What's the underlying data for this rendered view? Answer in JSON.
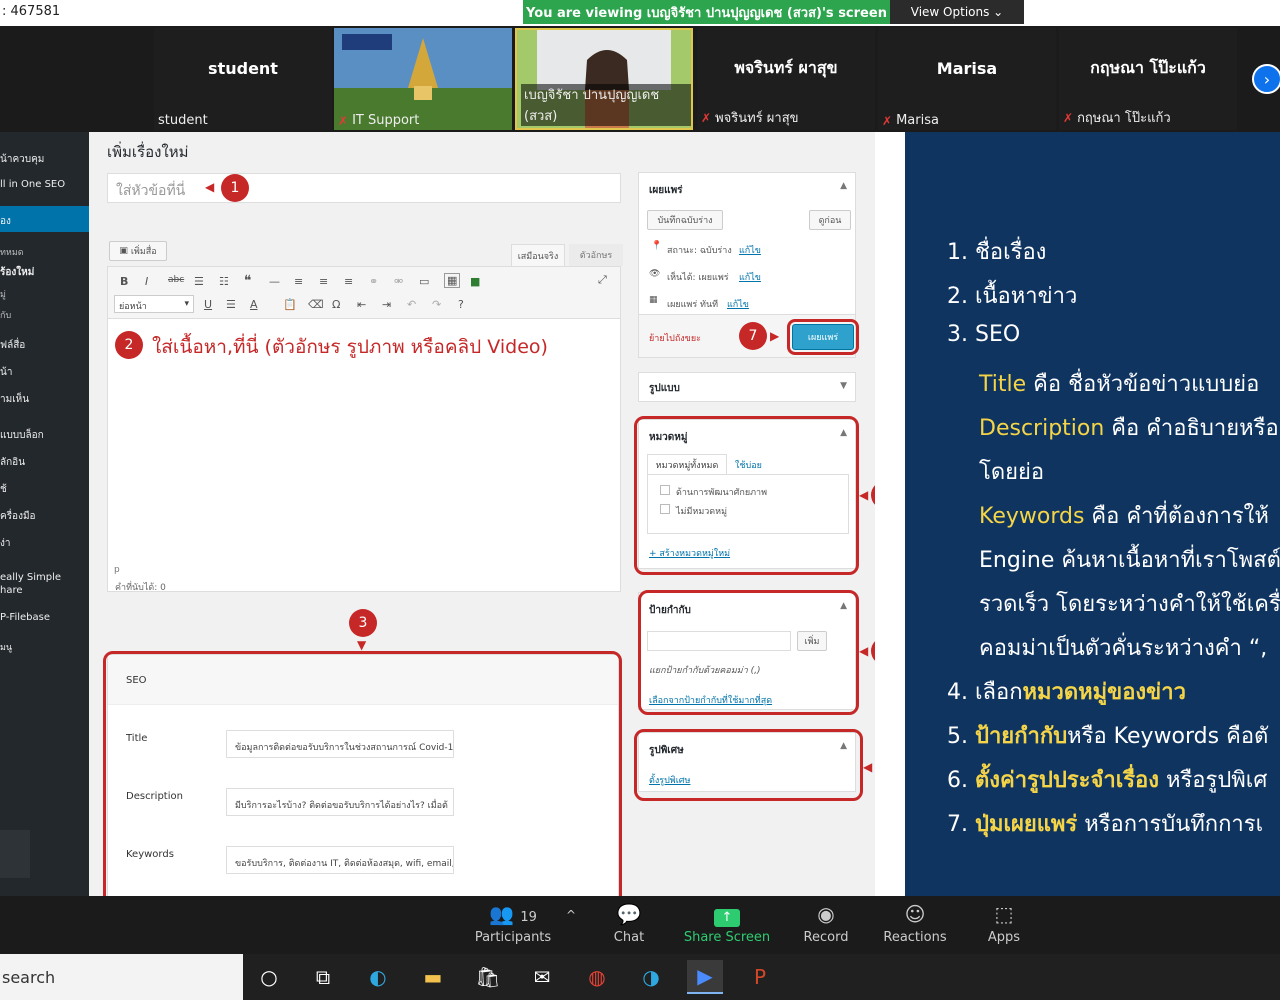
{
  "topbar": {
    "meeting_id": ": 467581",
    "viewing_banner": "You are viewing เบญจิรัชา ปานปุญญเดช (สวส)'s screen",
    "view_options": "View Options ⌄"
  },
  "participants_strip": [
    {
      "center": "student",
      "label": "student",
      "muted": false
    },
    {
      "center": "",
      "label": "IT Support",
      "muted": true
    },
    {
      "center": "",
      "label": "เบญจิรัชา ปานปุญญเดช (สวส)",
      "muted": false
    },
    {
      "center": "พจรินทร์ ผาสุข",
      "label": "พจรินทร์ ผาสุข",
      "muted": true
    },
    {
      "center": "Marisa",
      "label": "Marisa",
      "muted": true
    },
    {
      "center": "กฤษณา โป๊ะแก้ว",
      "label": "กฤษณา โป๊ะแก้ว",
      "muted": true
    }
  ],
  "wp_sidebar": [
    "น้าควบคุม",
    "ll in One SEO",
    "อง",
    "ทหมด",
    "ร้องใหม่",
    "มู่",
    "กับ",
    "ฟล์สื่อ",
    "น้า",
    "ามเห็น",
    "แบบบล็อก",
    "ลักอิน",
    "ช้",
    "ครื่องมือ",
    "ง่า",
    "eally Simple",
    "hare",
    "P-Filebase",
    "มนู"
  ],
  "editor": {
    "page_heading": "เพิ่มเรื่องใหม่",
    "title_placeholder": "ใส่หัวข้อที่นี่",
    "add_media": "เพิ่มสื่อ",
    "tab_visual": "เสมือนจริง",
    "tab_text": "ตัวอักษร",
    "format_select": "ย่อหน้า",
    "content_hint": "ใส่เนื้อหา,ที่นี่ (ตัวอักษร รูปภาพ หรือคลิป Video)",
    "path": "p",
    "word_count": "คำที่นับได้: 0"
  },
  "publish_box": {
    "title": "เผยแพร่",
    "save_draft": "บันทึกฉบับร่าง",
    "preview": "ดูก่อน",
    "status_label": "สถานะ: ฉบับร่าง",
    "visibility_label": "เห็นได้: เผยแพร่",
    "schedule_label": "เผยแพร่ ทันที",
    "edit_link": "แก้ไข",
    "trash": "ย้ายไปถังขยะ",
    "publish": "เผยแพร่"
  },
  "format_box": {
    "title": "รูปแบบ"
  },
  "category_box": {
    "title": "หมวดหมู่",
    "tab_all": "หมวดหมู่ทั้งหมด",
    "tab_popular": "ใช้บ่อย",
    "items": [
      "ด้านการพัฒนาศักยภาพ",
      "ไม่มีหมวดหมู่"
    ],
    "add_new": "+ สร้างหมวดหมู่ใหม่"
  },
  "tags_box": {
    "title": "ป้ายกำกับ",
    "add": "เพิ่ม",
    "hint": "แยกป้ายกำกับด้วยคอมม่า (,)",
    "choose": "เลือกจากป้ายกำกับที่ใช้มากที่สุด"
  },
  "featured_box": {
    "title": "รูปพิเศษ",
    "set": "ตั้งรูปพิเศษ"
  },
  "seo": {
    "title": "SEO",
    "fields": [
      {
        "label": "Title",
        "value": "ข้อมูลการติดต่อขอรับบริการในช่วงสถานการณ์ Covid-19"
      },
      {
        "label": "Description",
        "value": "มีบริการอะไรบ้าง? ติดต่อขอรับบริการได้อย่างไร? เมื่อต้"
      },
      {
        "label": "Keywords",
        "value": "ขอรับบริการ, ติดต่องาน IT, ติดต่อห้องสมุด, wifi, email,"
      }
    ]
  },
  "badges": [
    "1",
    "2",
    "3",
    "4",
    "5",
    "6",
    "7"
  ],
  "slide": {
    "l1": "1. ชื่อเรื่อง",
    "l2": "2. เนื้อหาข่าว",
    "l3": "3. SEO",
    "title_kw": "Title",
    "title_rest": " คือ ชื่อหัวข้อข่าวแบบย่อ",
    "desc_kw": "Description",
    "desc_rest": " คือ คำอธิบายหรือ",
    "desc_cont": "โดยย่อ",
    "kw_kw": "Keywords",
    "kw_rest": " คือ คำที่ต้องการให้",
    "kw_cont1": "Engine ค้นหาเนื้อหาที่เราโพสต์",
    "kw_cont2": "รวดเร็ว โดยระหว่างคำให้ใช้เครื่อ",
    "kw_cont3": "คอมม่าเป็นตัวคั่นระหว่างคำ  “,",
    "l4_pre": "4. เลือก",
    "l4_hl": "หมวดหมู่ของข่าว",
    "l5_pre": "5. ",
    "l5_hl": "ป้ายกำกับ",
    "l5_rest": "หรือ Keywords คือตั",
    "l6_pre": "6. ",
    "l6_hl": "ตั้งค่ารูปประจำเรื่อง",
    "l6_rest": " หรือรูปพิเศ",
    "l7_pre": "7. ",
    "l7_hl": "ปุ่มเผยแพร่",
    "l7_rest": " หรือการบันทึกการเ"
  },
  "zoom_toolbar": {
    "participants_count": "19",
    "participants": "Participants",
    "chat": "Chat",
    "share_screen": "Share Screen",
    "record": "Record",
    "reactions": "Reactions",
    "apps": "Apps"
  },
  "taskbar": {
    "search": "search"
  }
}
